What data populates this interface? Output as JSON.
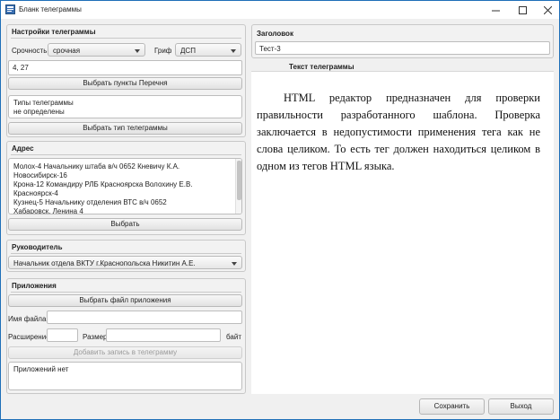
{
  "window": {
    "title": "Бланк телеграммы",
    "min_glyph": "—",
    "max_glyph": "☐",
    "close_glyph": "✕"
  },
  "settings": {
    "section_title": "Настройки телеграммы",
    "urgency_label": "Срочность",
    "urgency_value": "срочная",
    "classification_label": "Гриф",
    "classification_value": "ДСП",
    "points_value": "4, 27",
    "select_points_button": "Выбрать пункты Перечня",
    "types_lines": [
      "Типы телеграммы",
      "не определены"
    ],
    "select_type_button": "Выбрать тип телеграммы"
  },
  "address": {
    "section_title": "Адрес",
    "lines": [
      "Молох-4 Начальнику штаба в/ч 0652 Кневичу К.А.",
      "Новосибирск-16",
      "Крона-12 Командиру РЛБ Красноярска Волохину Е.В.",
      "Красноярск-4",
      "Кузнец-5 Начальнику отделения ВТС в/ч 0652",
      "Хабаровск, Ленина 4"
    ],
    "select_button": "Выбрать"
  },
  "head": {
    "section_title": "Руководитель",
    "value": "Начальник отдела ВКТУ г.Краснопольска Никитин А.Е."
  },
  "attachments": {
    "section_title": "Приложения",
    "choose_file_button": "Выбрать файл приложения",
    "filename_label": "Имя файла",
    "filename_value": "",
    "extension_label": "Расширение",
    "extension_value": "",
    "size_label": "Размер",
    "size_value": "",
    "size_unit": "байт",
    "add_record_button": "Добавить запись в телеграмму",
    "list_text": "Приложений нет"
  },
  "header_field": {
    "section_title": "Заголовок",
    "value": "Тест-3"
  },
  "editor": {
    "title": "Текст телеграммы",
    "body": "HTML редактор предназначен для проверки правильности разработанного шаблона. Проверка заключается в недопустимости применения тега как не слова целиком. То есть тег должен находиться целиком в одном из тегов HTML языка."
  },
  "footer": {
    "save_button": "Сохранить",
    "exit_button": "Выход"
  },
  "colors": {
    "window_border": "#1e6fb8",
    "panel_bg": "#f2f2f2",
    "app_icon": "#3a6fb3"
  }
}
